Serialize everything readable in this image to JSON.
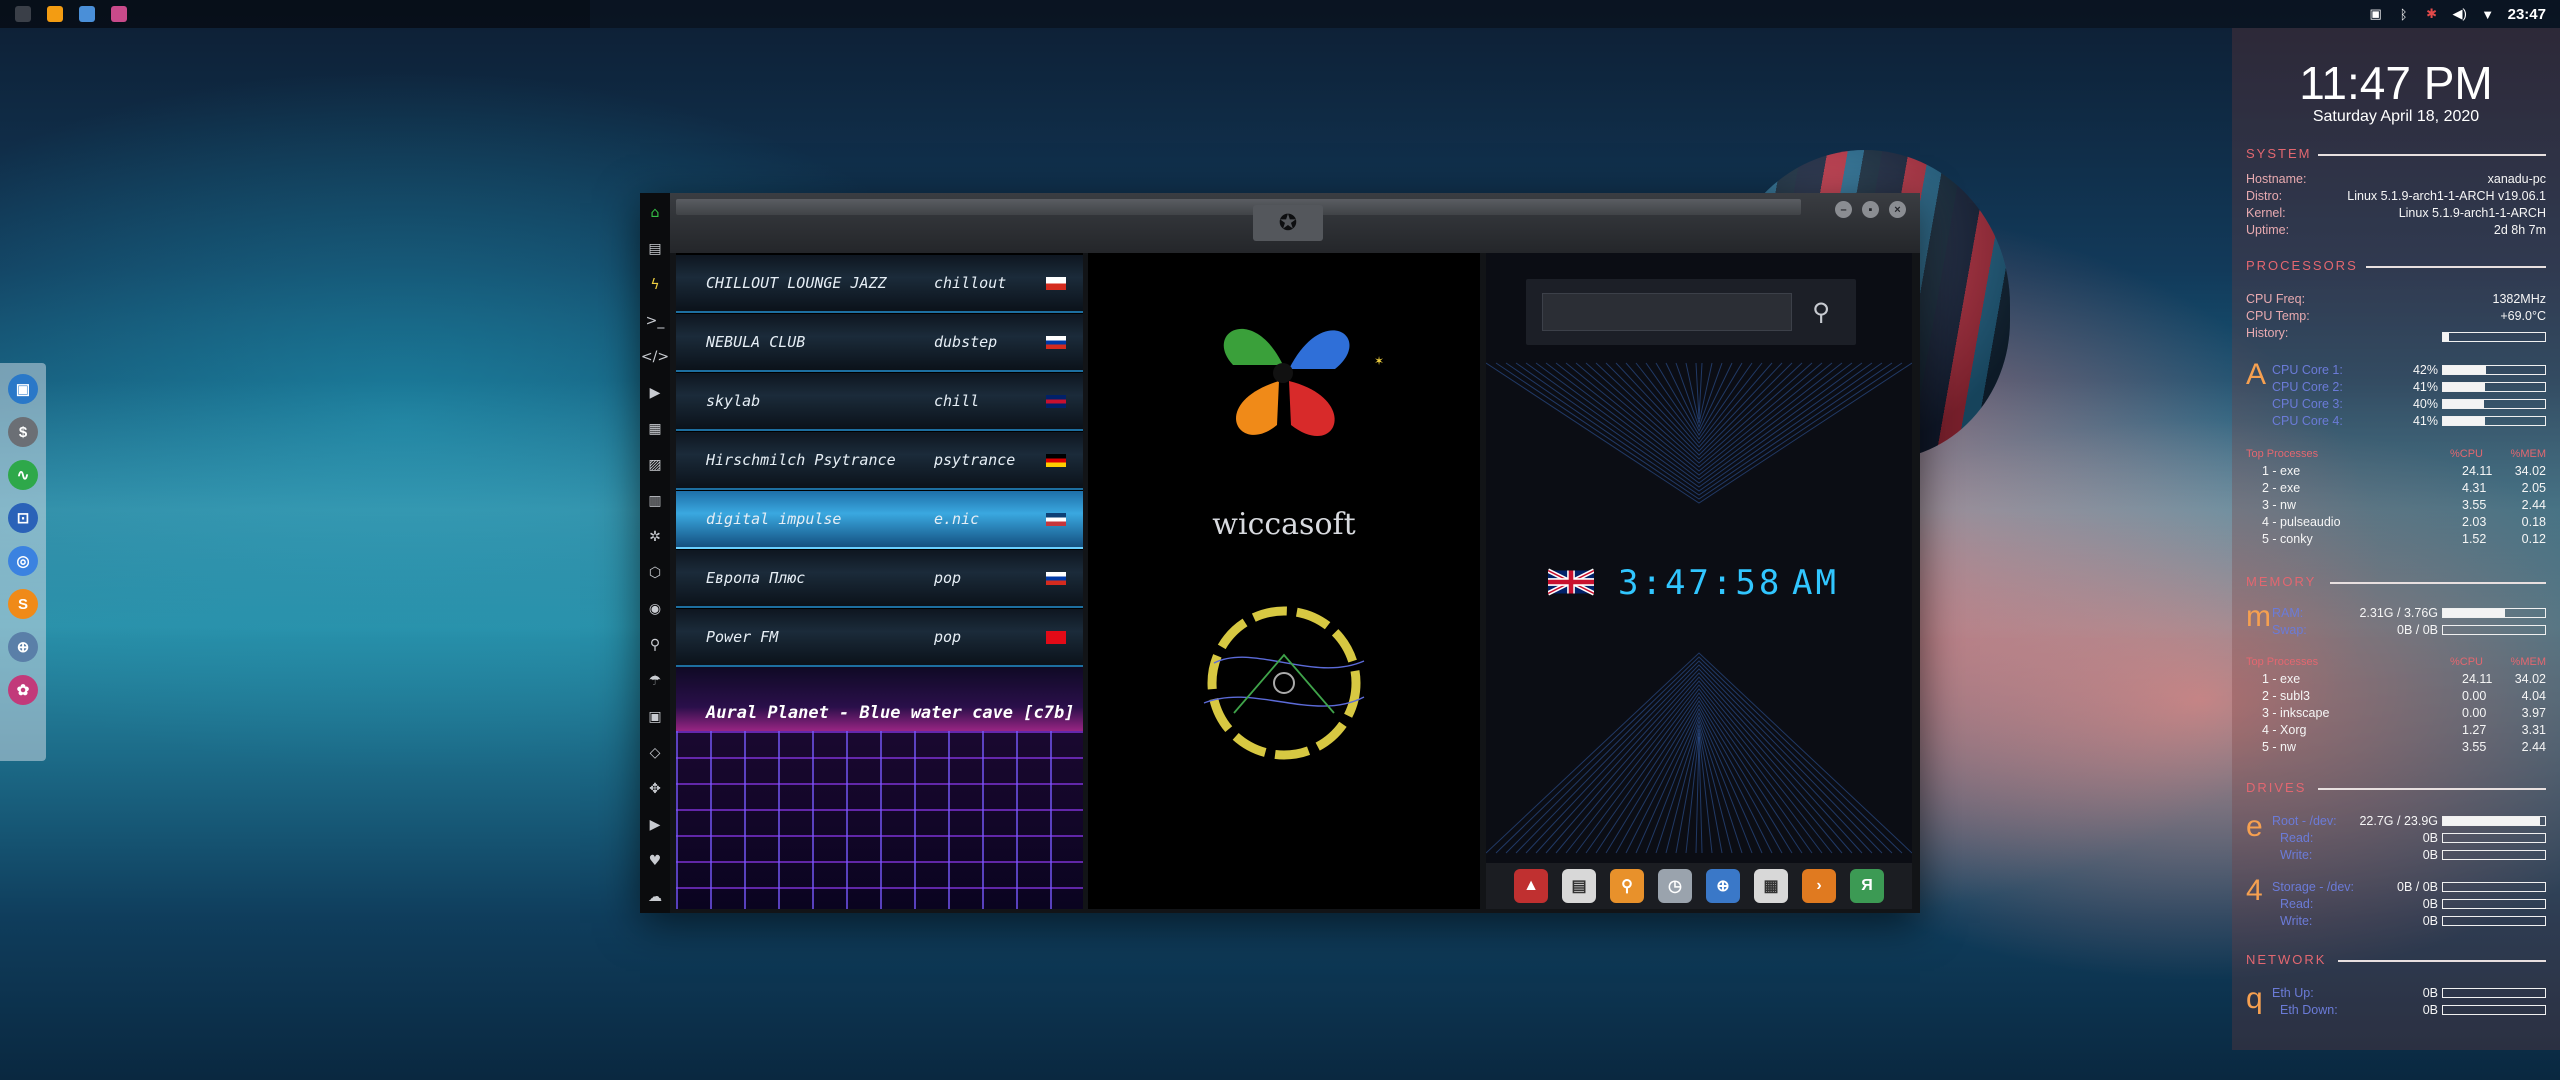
{
  "topbar": {
    "apps": [
      {
        "name": "app-launcher-icon",
        "color": "#3a3f48"
      },
      {
        "name": "sublime-icon",
        "color": "#f39c12"
      },
      {
        "name": "folder-icon",
        "color": "#4a8fd8"
      },
      {
        "name": "radio-app-icon",
        "color": "#c84a8a"
      }
    ],
    "clock": "23:47"
  },
  "dock": {
    "items": [
      {
        "name": "files-icon",
        "color": "#2a78c8",
        "glyph": "▣"
      },
      {
        "name": "dollar-icon",
        "color": "#6b6f75",
        "glyph": "$"
      },
      {
        "name": "system-monitor-icon",
        "color": "#2ea84a",
        "glyph": "∿"
      },
      {
        "name": "screenshot-icon",
        "color": "#2a62b8",
        "glyph": "⊡"
      },
      {
        "name": "chrome-icon",
        "color": "#3b82e0",
        "glyph": "◎"
      },
      {
        "name": "sublime-icon",
        "color": "#f08a18",
        "glyph": "S"
      },
      {
        "name": "globe-icon",
        "color": "#5a7fa8",
        "glyph": "⊕"
      },
      {
        "name": "radio-app-icon",
        "color": "#c23a7a",
        "glyph": "✿"
      }
    ]
  },
  "window": {
    "sidebar": [
      {
        "name": "home-icon",
        "glyph": "⌂",
        "color": "#35c045"
      },
      {
        "name": "document-icon",
        "glyph": "▤"
      },
      {
        "name": "lightning-icon",
        "glyph": "ϟ",
        "color": "#f0d040"
      },
      {
        "name": "terminal-icon",
        "glyph": ">_"
      },
      {
        "name": "code-icon",
        "glyph": "</>"
      },
      {
        "name": "play-icon",
        "glyph": "▶"
      },
      {
        "name": "media-icon",
        "glyph": "▦"
      },
      {
        "name": "image-icon",
        "glyph": "▨"
      },
      {
        "name": "news-icon",
        "glyph": "▥"
      },
      {
        "name": "settings-icon",
        "glyph": "✲"
      },
      {
        "name": "hexagon-icon",
        "glyph": "⬡"
      },
      {
        "name": "globe-icon",
        "glyph": "◉"
      },
      {
        "name": "search-icon",
        "glyph": "⚲"
      },
      {
        "name": "umbrella-icon",
        "glyph": "☂"
      },
      {
        "name": "contact-icon",
        "glyph": "▣"
      },
      {
        "name": "diamond-icon",
        "glyph": "◇"
      },
      {
        "name": "expand-icon",
        "glyph": "✥"
      },
      {
        "name": "youtube-icon",
        "glyph": "▶"
      },
      {
        "name": "heart-icon",
        "glyph": "♥"
      },
      {
        "name": "cloud-icon",
        "glyph": "☁"
      }
    ],
    "stations": [
      {
        "name": "CHILLOUT LOUNGE JAZZ",
        "genre": "chillout",
        "flag": [
          "#ffffff",
          "#d52b1e"
        ]
      },
      {
        "name": "NEBULA CLUB",
        "genre": "dubstep",
        "flag": [
          "#ffffff",
          "#0039a6",
          "#d52b1e"
        ]
      },
      {
        "name": "skylab",
        "genre": "chill",
        "flag": [
          "#012169",
          "#c8102e",
          "#012169"
        ]
      },
      {
        "name": "Hirschmilch Psytrance",
        "genre": "psytrance",
        "flag": [
          "#000000",
          "#dd0000",
          "#ffce00"
        ]
      },
      {
        "name": "digital impulse",
        "genre": "e.nic",
        "flag": [
          "#0c4076",
          "#ffffff",
          "#c6363c"
        ]
      },
      {
        "name": "Европа Плюс",
        "genre": "pop",
        "flag": [
          "#ffffff",
          "#0039a6",
          "#d52b1e"
        ]
      },
      {
        "name": "Power FM",
        "genre": "pop",
        "flag": [
          "#e30a17",
          "#e30a17"
        ]
      }
    ],
    "now_playing": "Aural Planet - Blue water cave [c7b]",
    "logo_text": "wiccasoft",
    "search_placeholder": "",
    "clock_time": "3:47:58",
    "clock_ampm": "AM",
    "quick_icons": [
      {
        "name": "arcade-icon",
        "color": "#c03030",
        "glyph": "▲"
      },
      {
        "name": "browser-window-icon",
        "color": "#d8d8d8",
        "glyph": "▤"
      },
      {
        "name": "search-app-icon",
        "color": "#e8912b",
        "glyph": "⚲"
      },
      {
        "name": "clock-icon",
        "color": "#9aa3ad",
        "glyph": "◷"
      },
      {
        "name": "globe-icon",
        "color": "#3a78c8",
        "glyph": "⊕"
      },
      {
        "name": "calendar-icon",
        "color": "#d8d8d8",
        "glyph": "▦"
      },
      {
        "name": "forward-icon",
        "color": "#e07a20",
        "glyph": "›"
      },
      {
        "name": "yandex-icon",
        "color": "#3c9a54",
        "glyph": "Я"
      }
    ]
  },
  "conky": {
    "time": "11:47 PM",
    "date": "Saturday April 18, 2020",
    "system_title": "SYSTEM",
    "system": [
      {
        "k": "Hostname:",
        "v": "xanadu-pc"
      },
      {
        "k": "Distro:",
        "v": "Linux 5.1.9-arch1-1-ARCH v19.06.1"
      },
      {
        "k": "Kernel:",
        "v": "Linux 5.1.9-arch1-1-ARCH"
      },
      {
        "k": "Uptime:",
        "v": "2d 8h 7m"
      }
    ],
    "processors_title": "PROCESSORS",
    "cpu": [
      {
        "k": "CPU Freq:",
        "v": "1382MHz"
      },
      {
        "k": "CPU Temp:",
        "v": "+69.0°C"
      },
      {
        "k": "History:",
        "v": ""
      }
    ],
    "cpu_letter": "A",
    "cores": [
      {
        "label": "CPU Core 1:",
        "value": "42%",
        "level": 0.42
      },
      {
        "label": "CPU Core 2:",
        "value": "41%",
        "level": 0.41
      },
      {
        "label": "CPU Core 3:",
        "value": "40%",
        "level": 0.4
      },
      {
        "label": "CPU Core 4:",
        "value": "41%",
        "level": 0.41
      }
    ],
    "top_cpu_header": {
      "title": "Top Processes",
      "a": "%CPU",
      "b": "%MEM"
    },
    "top_cpu": [
      {
        "n": "1 - exe",
        "a": "24.11",
        "b": "34.02"
      },
      {
        "n": "2 - exe",
        "a": "4.31",
        "b": "2.05"
      },
      {
        "n": "3 - nw",
        "a": "3.55",
        "b": "2.44"
      },
      {
        "n": "4 - pulseaudio",
        "a": "2.03",
        "b": "0.18"
      },
      {
        "n": "5 - conky",
        "a": "1.52",
        "b": "0.12"
      }
    ],
    "memory_title": "MEMORY",
    "mem_letter": "m",
    "ram": {
      "label": "RAM:",
      "value": "2.31G / 3.76G",
      "level": 0.61
    },
    "swap": {
      "label": "Swap:",
      "value": "0B / 0B",
      "level": 0
    },
    "top_mem_header": {
      "title": "Top Processes",
      "a": "%CPU",
      "b": "%MEM"
    },
    "top_mem": [
      {
        "n": "1 - exe",
        "a": "24.11",
        "b": "34.02"
      },
      {
        "n": "2 - subl3",
        "a": "0.00",
        "b": "4.04"
      },
      {
        "n": "3 - inkscape",
        "a": "0.00",
        "b": "3.97"
      },
      {
        "n": "4 - Xorg",
        "a": "1.27",
        "b": "3.31"
      },
      {
        "n": "5 - nw",
        "a": "3.55",
        "b": "2.44"
      }
    ],
    "disk_title": "DRIVES",
    "disk_letter": "e",
    "root": {
      "label": "Root - /dev:",
      "value": "22.7G / 23.9G",
      "level": 0.95
    },
    "root_read": {
      "label": "Read:",
      "value": "0B"
    },
    "root_write": {
      "label": "Write:",
      "value": "0B"
    },
    "home_letter": "4",
    "home": {
      "label": "Storage - /dev:",
      "value": "0B / 0B",
      "level": 0
    },
    "home_read": {
      "label": "Read:",
      "value": "0B"
    },
    "home_write": {
      "label": "Write:",
      "value": "0B"
    },
    "network_title": "NETWORK",
    "net_letter": "q",
    "net_up": {
      "label": "Eth Up:",
      "value": "0B"
    },
    "net_down": {
      "label": "Eth Down:",
      "value": "0B"
    }
  }
}
